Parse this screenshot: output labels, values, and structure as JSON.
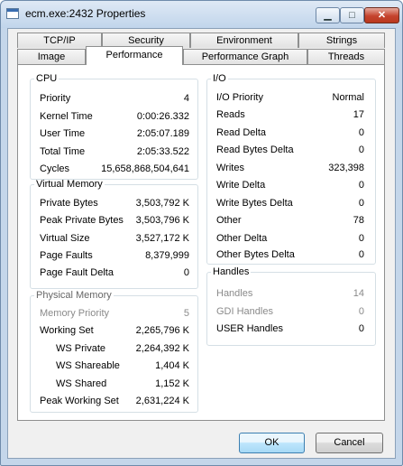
{
  "window": {
    "title": "ecm.exe:2432 Properties"
  },
  "caption": {
    "minimize": "▁",
    "maximize": "□",
    "close": "✕"
  },
  "tabs_back": [
    "TCP/IP",
    "Security",
    "Environment",
    "Strings"
  ],
  "tabs_front": [
    "Image",
    "Performance",
    "Performance Graph",
    "Threads"
  ],
  "selected_tab": "Performance",
  "cpu": {
    "title": "CPU",
    "rows": [
      {
        "label": "Priority",
        "value": "4"
      },
      {
        "label": "Kernel Time",
        "value": "0:00:26.332"
      },
      {
        "label": "User Time",
        "value": "2:05:07.189"
      },
      {
        "label": "Total Time",
        "value": "2:05:33.522"
      },
      {
        "label": "Cycles",
        "value": "15,658,868,504,641"
      }
    ]
  },
  "virtual_memory": {
    "title": "Virtual Memory",
    "rows": [
      {
        "label": "Private Bytes",
        "value": "3,503,792 K"
      },
      {
        "label": "Peak Private Bytes",
        "value": "3,503,796 K"
      },
      {
        "label": "Virtual Size",
        "value": "3,527,172 K"
      },
      {
        "label": "Page Faults",
        "value": "8,379,999"
      },
      {
        "label": "Page Fault Delta",
        "value": "0"
      }
    ]
  },
  "physical_memory": {
    "title": "Physical Memory",
    "rows": [
      {
        "label": "Memory Priority",
        "value": "5"
      },
      {
        "label": "Working Set",
        "value": "2,265,796 K"
      },
      {
        "label": "WS Private",
        "value": "2,264,392 K"
      },
      {
        "label": "WS Shareable",
        "value": "1,404 K"
      },
      {
        "label": "WS Shared",
        "value": "1,152 K"
      },
      {
        "label": "Peak Working Set",
        "value": "2,631,224 K"
      }
    ]
  },
  "io": {
    "title": "I/O",
    "rows": [
      {
        "label": "I/O Priority",
        "value": "Normal"
      },
      {
        "label": "Reads",
        "value": "17"
      },
      {
        "label": "Read Delta",
        "value": "0"
      },
      {
        "label": "Read Bytes Delta",
        "value": "0"
      },
      {
        "label": "Writes",
        "value": "323,398"
      },
      {
        "label": "Write Delta",
        "value": "0"
      },
      {
        "label": "Write Bytes Delta",
        "value": "0"
      },
      {
        "label": "Other",
        "value": "78"
      },
      {
        "label": "Other Delta",
        "value": "0"
      },
      {
        "label": "Other Bytes Delta",
        "value": "0"
      }
    ]
  },
  "handles": {
    "title": "Handles",
    "rows": [
      {
        "label": "Handles",
        "value": "14"
      },
      {
        "label": "GDI Handles",
        "value": "0"
      },
      {
        "label": "USER Handles",
        "value": "0"
      }
    ]
  },
  "buttons": {
    "ok": "OK",
    "cancel": "Cancel"
  }
}
